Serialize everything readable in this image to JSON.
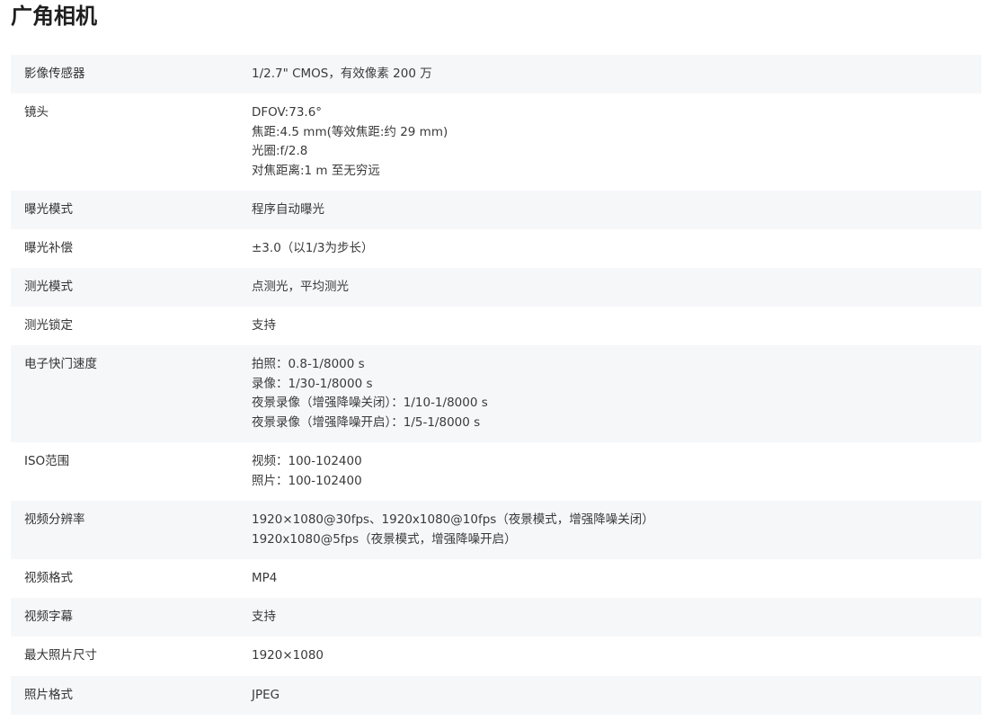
{
  "title": "广角相机",
  "rows": [
    {
      "label": "影像传感器",
      "values": [
        "1/2.7\" CMOS，有效像素 200 万"
      ]
    },
    {
      "label": "镜头",
      "values": [
        "DFOV:73.6°",
        "焦距:4.5 mm(等效焦距:约 29 mm)",
        "光圈:f/2.8",
        "对焦距离:1 m 至无穷远"
      ]
    },
    {
      "label": "曝光模式",
      "values": [
        "程序自动曝光"
      ]
    },
    {
      "label": "曝光补偿",
      "values": [
        "±3.0（以1/3为步长）"
      ]
    },
    {
      "label": "测光模式",
      "values": [
        "点测光，平均测光"
      ]
    },
    {
      "label": "测光锁定",
      "values": [
        "支持"
      ]
    },
    {
      "label": "电子快门速度",
      "values": [
        "拍照：0.8-1/8000 s",
        "录像：1/30-1/8000 s",
        "夜景录像（增强降噪关闭）：1/10-1/8000 s",
        "夜景录像（增强降噪开启）：1/5-1/8000 s"
      ]
    },
    {
      "label": "ISO范围",
      "values": [
        "视频：100-102400",
        "照片：100-102400"
      ]
    },
    {
      "label": "视频分辨率",
      "values": [
        "1920×1080@30fps、1920x1080@10fps（夜景模式，增强降噪关闭）",
        "1920x1080@5fps（夜景模式，增强降噪开启）"
      ]
    },
    {
      "label": "视频格式",
      "values": [
        "MP4"
      ]
    },
    {
      "label": "视频字幕",
      "values": [
        "支持"
      ]
    },
    {
      "label": "最大照片尺寸",
      "values": [
        "1920×1080"
      ]
    },
    {
      "label": "照片格式",
      "values": [
        "JPEG"
      ]
    }
  ]
}
